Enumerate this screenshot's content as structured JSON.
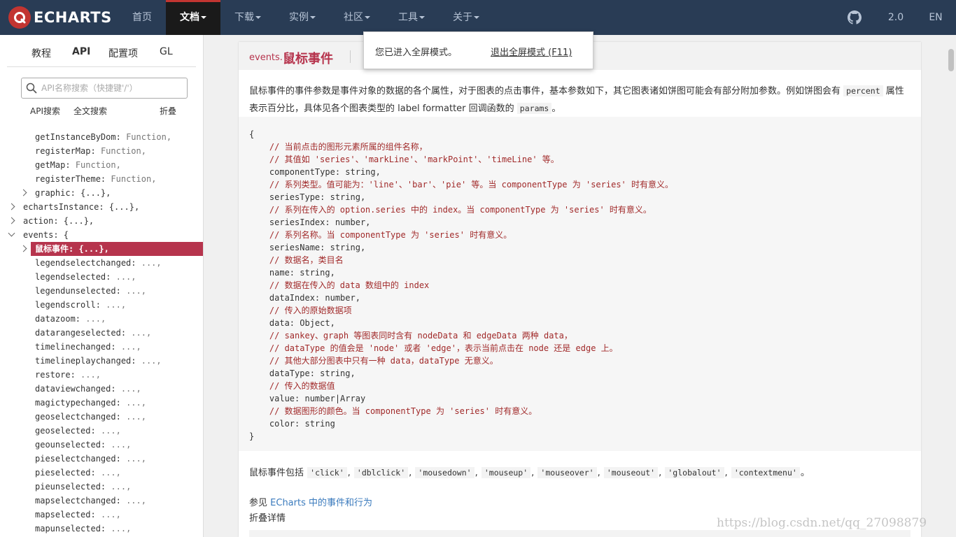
{
  "nav": {
    "brand": "ECHARTS",
    "items": [
      {
        "label": "首页",
        "caret": false
      },
      {
        "label": "文档",
        "caret": true
      },
      {
        "label": "下载",
        "caret": true
      },
      {
        "label": "实例",
        "caret": true
      },
      {
        "label": "社区",
        "caret": true
      },
      {
        "label": "工具",
        "caret": true
      },
      {
        "label": "关于",
        "caret": true
      }
    ],
    "version": "2.0",
    "lang": "EN",
    "accent": "#c23531",
    "bg": "#293c55"
  },
  "sidebar": {
    "tabs": [
      "教程",
      "API",
      "配置项",
      "GL"
    ],
    "search_placeholder": "API名称搜索（快捷键'/'）",
    "search_options": [
      "API搜索",
      "全文搜索",
      "折叠"
    ],
    "tree": [
      {
        "key": "getInstanceByDom:",
        "value": "Function,"
      },
      {
        "key": "registerMap:",
        "value": "Function,"
      },
      {
        "key": "getMap:",
        "value": "Function,"
      },
      {
        "key": "registerTheme:",
        "value": "Function,"
      },
      {
        "key": "graphic: {...},",
        "value": ""
      },
      {
        "key": "echartsInstance: {...},",
        "value": ""
      },
      {
        "key": "action: {...},",
        "value": ""
      },
      {
        "key": "events: {",
        "value": ""
      },
      {
        "key": "鼠标事件: {...},",
        "value": ""
      },
      {
        "key": "legendselectchanged:",
        "value": "...,"
      },
      {
        "key": "legendselected:",
        "value": "...,"
      },
      {
        "key": "legendunselected:",
        "value": "...,"
      },
      {
        "key": "legendscroll:",
        "value": "...,"
      },
      {
        "key": "datazoom:",
        "value": "...,"
      },
      {
        "key": "datarangeselected:",
        "value": "...,"
      },
      {
        "key": "timelinechanged:",
        "value": "...,"
      },
      {
        "key": "timelineplaychanged:",
        "value": "...,"
      },
      {
        "key": "restore:",
        "value": "...,"
      },
      {
        "key": "dataviewchanged:",
        "value": "...,"
      },
      {
        "key": "magictypechanged:",
        "value": "...,"
      },
      {
        "key": "geoselectchanged:",
        "value": "...,"
      },
      {
        "key": "geoselected:",
        "value": "...,"
      },
      {
        "key": "geounselected:",
        "value": "...,"
      },
      {
        "key": "pieselectchanged:",
        "value": "...,"
      },
      {
        "key": "pieselected:",
        "value": "...,"
      },
      {
        "key": "pieunselected:",
        "value": "...,"
      },
      {
        "key": "mapselectchanged:",
        "value": "...,"
      },
      {
        "key": "mapselected:",
        "value": "...,"
      },
      {
        "key": "mapunselected:",
        "value": "...,"
      }
    ]
  },
  "content": {
    "prefix": "events.",
    "title": "鼠标事件",
    "desc_part1": "鼠标事件的事件参数是事件对象的数据的各个属性，对于图表的点击事件，基本参数如下，其它图表诸如饼图可能会有部分附加参数。例如饼图会有",
    "desc_code1": "percent",
    "desc_part2": "属性表示百分比，具体见各个图表类型的 label formatter 回调函数的",
    "desc_code2": "params",
    "desc_part3": "。",
    "code_lines": [
      "{",
      "    // 当前点击的图形元素所属的组件名称，",
      "    // 其值如 'series'、'markLine'、'markPoint'、'timeLine' 等。",
      "    componentType: string,",
      "    // 系列类型。值可能为：'line'、'bar'、'pie' 等。当 componentType 为 'series' 时有意义。",
      "    seriesType: string,",
      "    // 系列在传入的 option.series 中的 index。当 componentType 为 'series' 时有意义。",
      "    seriesIndex: number,",
      "    // 系列名称。当 componentType 为 'series' 时有意义。",
      "    seriesName: string,",
      "    // 数据名，类目名",
      "    name: string,",
      "    // 数据在传入的 data 数组中的 index",
      "    dataIndex: number,",
      "    // 传入的原始数据项",
      "    data: Object,",
      "    // sankey、graph 等图表同时含有 nodeData 和 edgeData 两种 data，",
      "    // dataType 的值会是 'node' 或者 'edge'，表示当前点击在 node 还是 edge 上。",
      "    // 其他大部分图表中只有一种 data，dataType 无意义。",
      "    dataType: string,",
      "    // 传入的数据值",
      "    value: number|Array",
      "    // 数据图形的颜色。当 componentType 为 'series' 时有意义。",
      "    color: string",
      "}"
    ],
    "events_prefix": "鼠标事件包括",
    "events": [
      "'click'",
      "'dblclick'",
      "'mousedown'",
      "'mouseup'",
      "'mouseover'",
      "'mouseout'",
      "'globalout'",
      "'contextmenu'"
    ],
    "events_suffix": "。",
    "seealso_prefix": "参见",
    "seealso_link": "ECharts 中的事件和行为",
    "collapse_detail": "折叠详情"
  },
  "popup": {
    "message": "您已进入全屏模式。",
    "exit": "退出全屏模式 (F11)"
  },
  "watermark": "https://blog.csdn.net/qq_27098879",
  "colors": {
    "highlight": "#b6344d",
    "comment": "#a12a2a",
    "link": "#3b7bbd"
  }
}
